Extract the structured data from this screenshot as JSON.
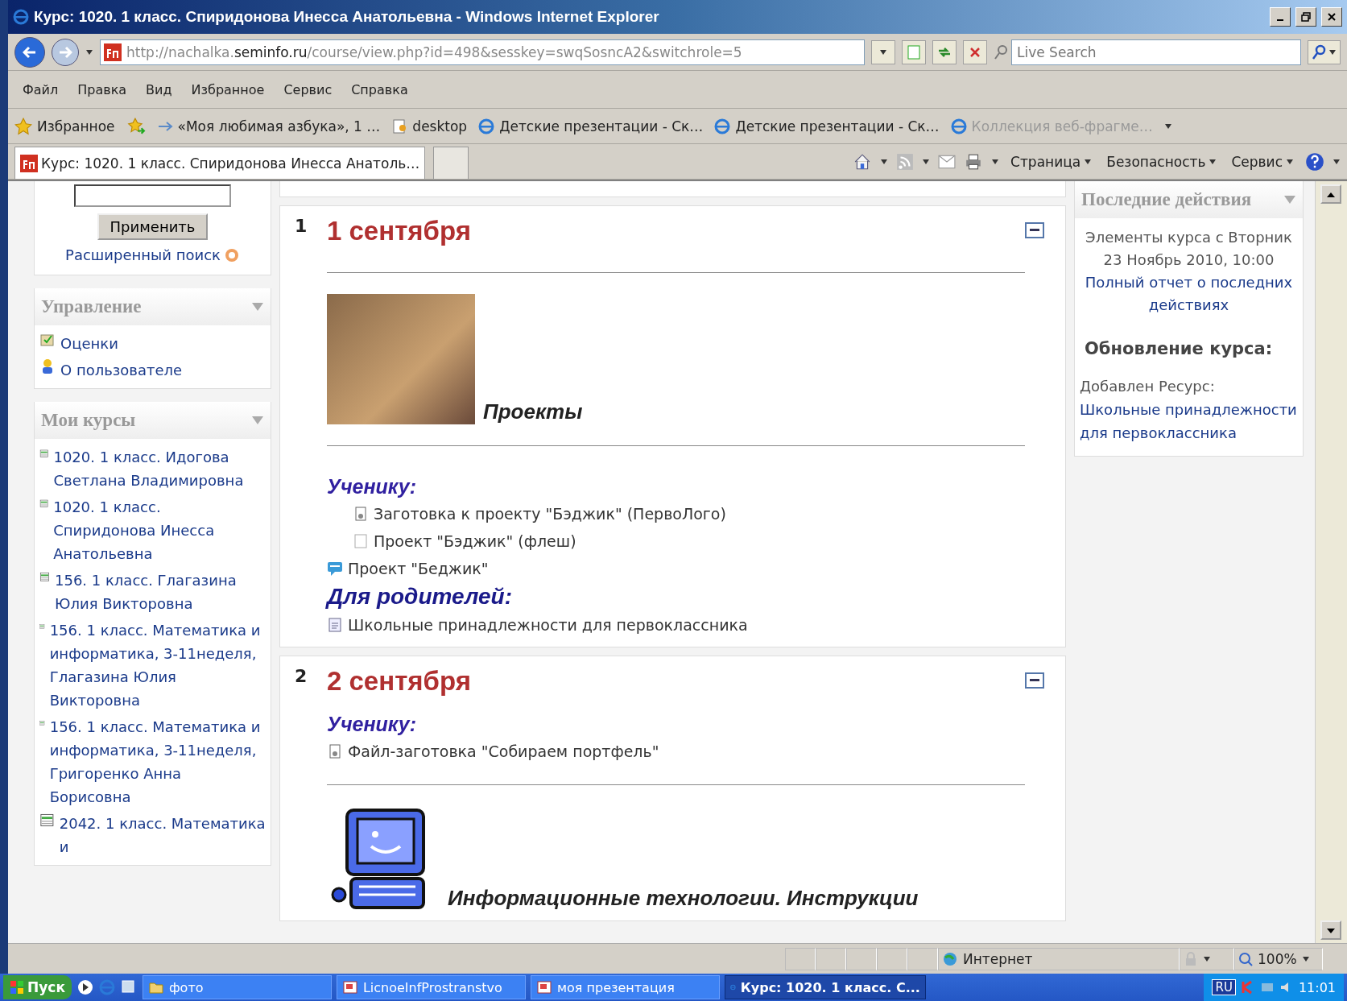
{
  "window": {
    "title": "Курс: 1020. 1 класс. Спиридонова Инесса Анатольевна - Windows Internet Explorer"
  },
  "address_bar": {
    "url_prefix": "http://nachalka.",
    "url_host": "seminfo.ru",
    "url_path": "/course/view.php?id=498&sesskey=swqSosncA2&switchrole=5",
    "search_placeholder": "Live Search"
  },
  "menu": [
    "Файл",
    "Правка",
    "Вид",
    "Избранное",
    "Сервис",
    "Справка"
  ],
  "favorites_bar": {
    "label": "Избранное",
    "links": [
      {
        "label": "«Моя любимая азбука», 1 …",
        "kind": "link",
        "disabled": false
      },
      {
        "label": "desktop",
        "kind": "page",
        "disabled": false
      },
      {
        "label": "Детские презентации - Ск…",
        "kind": "ie",
        "disabled": false
      },
      {
        "label": "Детские презентации - Ск…",
        "kind": "ie",
        "disabled": false
      },
      {
        "label": "Коллекция веб-фрагме…",
        "kind": "ie",
        "disabled": true
      }
    ]
  },
  "tab": {
    "title": "Курс: 1020. 1 класс. Спиридонова Инесса Анатоль…"
  },
  "command_bar": [
    "Страница",
    "Безопасность",
    "Сервис"
  ],
  "left": {
    "search_button": "Применить",
    "advanced_search": "Расширенный поиск",
    "blocks": [
      {
        "title": "Управление",
        "items": [
          {
            "label": "Оценки",
            "kind": "grades"
          },
          {
            "label": "О пользователе",
            "kind": "user"
          }
        ]
      },
      {
        "title": "Мои курсы",
        "items": [
          {
            "label": "1020. 1 класс. Идогова Светлана Владимировна",
            "kind": "course"
          },
          {
            "label": "1020. 1 класс. Спиридонова Инесса Анатольевна",
            "kind": "course"
          },
          {
            "label": "156. 1 класс. Глагазина Юлия Викторовна",
            "kind": "course"
          },
          {
            "label": "156. 1 класс. Математика и информатика, 3-11неделя, Глагазина Юлия Викторовна",
            "kind": "course"
          },
          {
            "label": "156. 1 класс. Математика и информатика, 3-11неделя, Григоренко Анна Борисовна",
            "kind": "course"
          },
          {
            "label": "2042. 1 класс. Математика и",
            "kind": "course"
          }
        ]
      }
    ]
  },
  "sections": [
    {
      "number": "1",
      "title": "1 сентября",
      "items": [
        {
          "kind": "rule"
        },
        {
          "kind": "photo",
          "caption": "Проекты"
        },
        {
          "kind": "rule"
        },
        {
          "kind": "subheading",
          "text": "Ученику:"
        },
        {
          "kind": "file",
          "text": "Заготовка к проекту \"Бэджик\" (ПервоЛого)",
          "indented": true
        },
        {
          "kind": "blank",
          "text": "Проект \"Бэджик\" (флеш)",
          "indented": true
        },
        {
          "kind": "forum",
          "text": "Проект \"Беджик\"",
          "indented": false
        },
        {
          "kind": "heading",
          "text": "Для родителей:"
        },
        {
          "kind": "doc",
          "text": "Школьные принадлежности для первоклассника",
          "indented": false
        }
      ]
    },
    {
      "number": "2",
      "title": "2 сентября",
      "items": [
        {
          "kind": "subheading",
          "text": "Ученику:"
        },
        {
          "kind": "file",
          "text": "Файл-заготовка \"Собираем портфель\"",
          "indented": false
        },
        {
          "kind": "rule"
        },
        {
          "kind": "computer",
          "caption": "Информационные технологии. Инструкции"
        }
      ]
    }
  ],
  "right": {
    "title": "Последние действия",
    "since": "Элементы курса с Вторник 23 Ноябрь 2010, 10:00",
    "report_link": "Полный отчет о последних действиях",
    "updates_title": "Обновление курса:",
    "added": "Добавлен Ресурс:",
    "added_link": "Школьные принадлежности для первоклассника"
  },
  "status_bar": {
    "zone": "Интернет",
    "zoom": "100%"
  },
  "taskbar": {
    "start": "Пуск",
    "tasks": [
      {
        "label": "фото",
        "kind": "folder",
        "selected": false
      },
      {
        "label": "LicnoeInfProstranstvo",
        "kind": "ppt",
        "selected": false
      },
      {
        "label": "моя презентация",
        "kind": "ppt",
        "selected": false
      },
      {
        "label": "Курс: 1020. 1 класс. С...",
        "kind": "ie",
        "selected": true
      }
    ],
    "language": "RU",
    "clock": "11:01"
  }
}
